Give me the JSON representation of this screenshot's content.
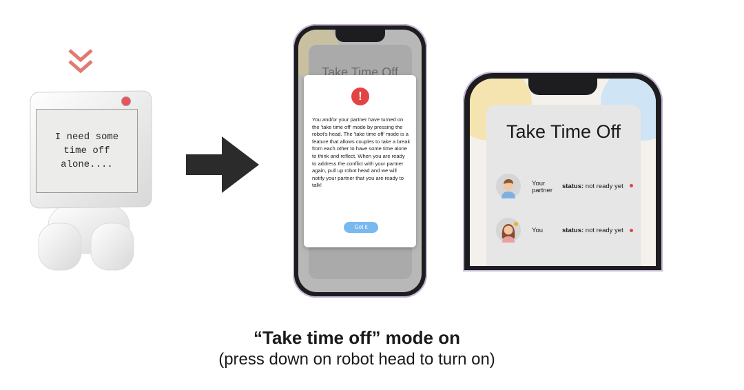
{
  "robot": {
    "screen_text": "I need some\ntime off\nalone....",
    "light_color": "#f0505a",
    "pointer_icon": "double-chevron-down-icon"
  },
  "arrow_icon": "right-arrow-icon",
  "phone_alert": {
    "background_title": "Take Time Off",
    "alert_icon": "exclamation-icon",
    "message": "You and/or your partner have turned on the 'take time off' mode by pressing the robot's head. The 'take time off' mode is a feature that allows couples to take a break from each other to have some time alone to think and reflect. When you are ready to address the conflict with your partner again, pull up robot head and we will notify your partner that you are ready to talk!",
    "button_label": "Got it",
    "button_color": "#7ab8f0"
  },
  "phone_status": {
    "title": "Take Time Off",
    "people": [
      {
        "label": "Your partner",
        "status_label": "status:",
        "status_value": "not ready yet",
        "avatar_icon": "man-avatar-icon"
      },
      {
        "label": "You",
        "status_label": "status:",
        "status_value": "not ready yet",
        "avatar_icon": "woman-avatar-icon"
      }
    ],
    "status_dot_color": "#e24343"
  },
  "caption": {
    "title": "“Take time off” mode on",
    "subtitle": "(press down on robot head to turn on)"
  }
}
